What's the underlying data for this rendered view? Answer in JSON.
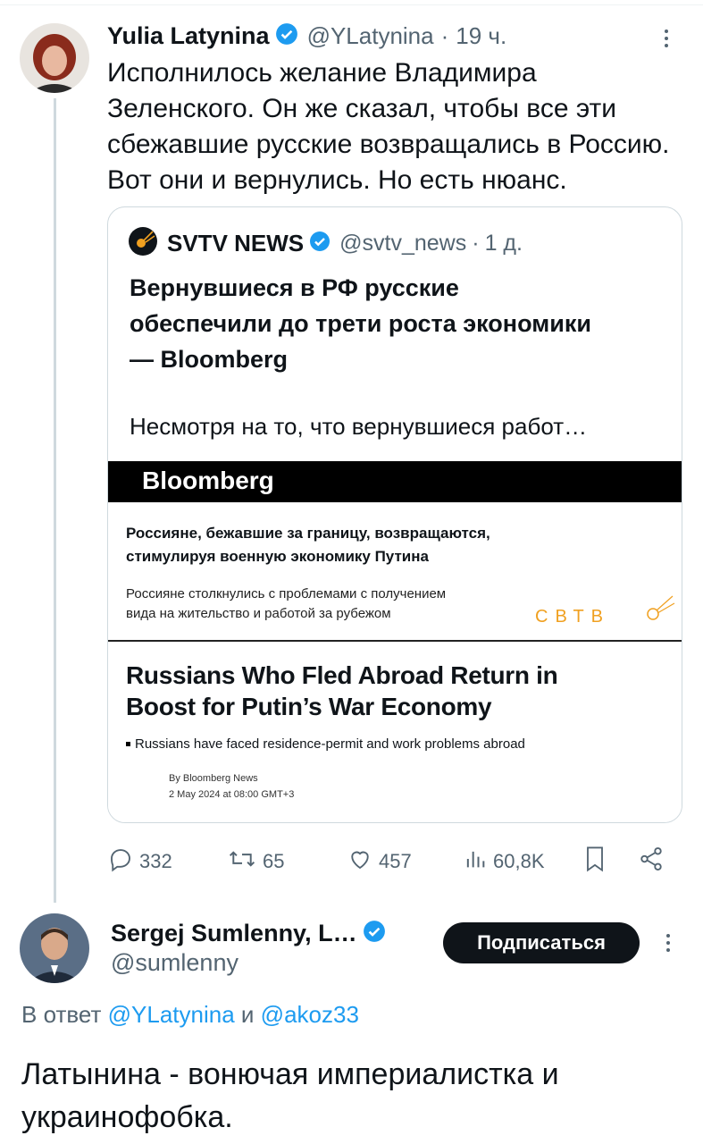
{
  "tweet1": {
    "display_name": "Yulia Latynina",
    "handle": "@YLatynina",
    "sep": "·",
    "time": "19 ч.",
    "text_lines": [
      "Исполнилось желание Владимира",
      "Зеленского. Он же сказал, чтобы все эти",
      "сбежавшие русские возвращались в Россию.",
      "Вот они и вернулись. Но есть нюанс."
    ]
  },
  "quote": {
    "display_name": "SVTV NEWS",
    "handle": "@svtv_news",
    "sep": "·",
    "time": "1 д.",
    "headline_lines": [
      "Вернувшиеся в РФ русские",
      "обеспечили до трети роста экономики",
      "— Bloomberg"
    ],
    "snippet": "Несмотря на то, что вернувшиеся работ…"
  },
  "article_image": {
    "banner": "Bloomberg",
    "ru_title_lines": [
      "Россияне, бежавшие за границу, возвращаются,",
      "стимулируя военную экономику Путина"
    ],
    "ru_sub_lines": [
      "Россияне столкнулись с проблемами с получением",
      "вида на жительство и работой за рубежом"
    ],
    "watermark": "СВТВ",
    "en_title_lines": [
      "Russians Who Fled Abroad Return in",
      "Boost for Putin’s War Economy"
    ],
    "en_bullet": "Russians have faced residence-permit and work problems abroad",
    "byline": "By Bloomberg News",
    "dateline": "2 May 2024 at 08:00 GMT+3"
  },
  "actions": {
    "replies": "332",
    "retweets": "65",
    "likes": "457",
    "views": "60,8K"
  },
  "tweet2": {
    "display_name": "Sergej Sumlenny, L…",
    "handle": "@sumlenny",
    "follow_label": "Подписаться",
    "reply_prefix": "В ответ",
    "reply_handle1": "@YLatynina",
    "reply_and": "и",
    "reply_handle2": "@akoz33",
    "text_lines": [
      "Латынина - вонючая империалистка и",
      "украинофобка."
    ]
  },
  "colors": {
    "accent": "#1d9bf0",
    "text": "#0f1419",
    "muted": "#536471",
    "border": "#cfd9de",
    "verified": "#1d9bf0",
    "watermark": "#f0a020"
  }
}
